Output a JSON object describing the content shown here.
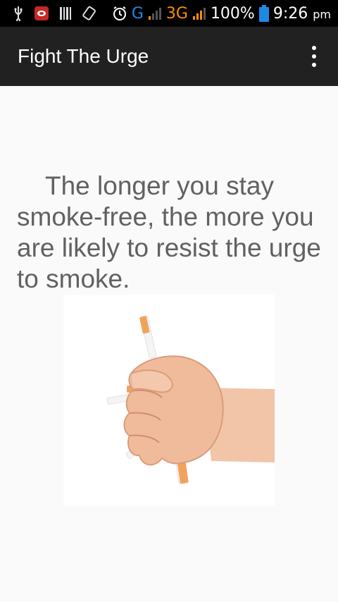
{
  "status_bar": {
    "network_g": "G",
    "network_3g": "3G",
    "battery": "100%",
    "time": "9:26",
    "time_suffix": "pm",
    "icons": [
      "usb-icon",
      "app-notification-icon",
      "barcode-icon",
      "sync-icon",
      "alarm-icon",
      "signal-icon",
      "battery-icon"
    ],
    "colors": {
      "g": "#1e88e5",
      "three_g": "#ff8f00",
      "battery": "#1e88e5"
    }
  },
  "app_bar": {
    "title": "Fight The Urge",
    "overflow_icon": "more-vert-icon"
  },
  "main": {
    "message": "The longer you stay smoke-free, the more you are likely to resist the urge to smoke.",
    "image": "hand-crushing-cigarettes-illustration"
  }
}
